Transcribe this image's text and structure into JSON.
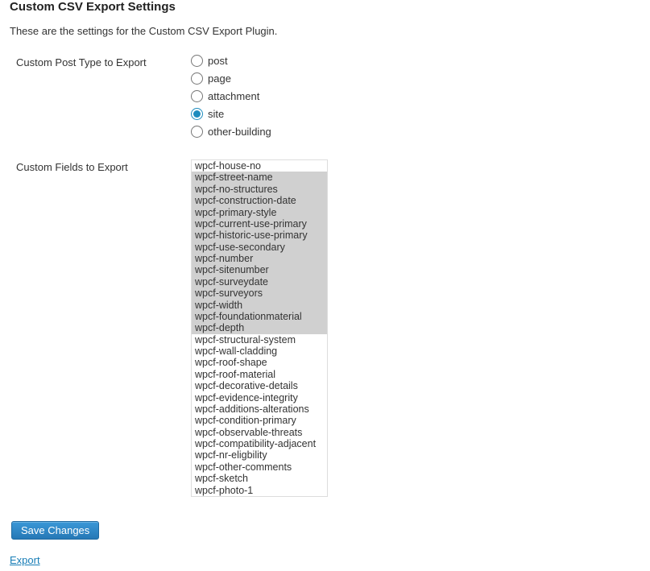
{
  "page_title": "Custom CSV Export Settings",
  "description": "These are the settings for the Custom CSV Export Plugin.",
  "post_type_section": {
    "label": "Custom Post Type to Export",
    "options": [
      {
        "label": "post",
        "checked": false
      },
      {
        "label": "page",
        "checked": false
      },
      {
        "label": "attachment",
        "checked": false
      },
      {
        "label": "site",
        "checked": true
      },
      {
        "label": "other-building",
        "checked": false
      }
    ]
  },
  "custom_fields_section": {
    "label": "Custom Fields to Export",
    "options": [
      {
        "label": "wpcf-house-no",
        "selected": false
      },
      {
        "label": "wpcf-street-name",
        "selected": true
      },
      {
        "label": "wpcf-no-structures",
        "selected": true
      },
      {
        "label": "wpcf-construction-date",
        "selected": true
      },
      {
        "label": "wpcf-primary-style",
        "selected": true
      },
      {
        "label": "wpcf-current-use-primary",
        "selected": true
      },
      {
        "label": "wpcf-historic-use-primary",
        "selected": true
      },
      {
        "label": "wpcf-use-secondary",
        "selected": true
      },
      {
        "label": "wpcf-number",
        "selected": true
      },
      {
        "label": "wpcf-sitenumber",
        "selected": true
      },
      {
        "label": "wpcf-surveydate",
        "selected": true
      },
      {
        "label": "wpcf-surveyors",
        "selected": true
      },
      {
        "label": "wpcf-width",
        "selected": true
      },
      {
        "label": "wpcf-foundationmaterial",
        "selected": true
      },
      {
        "label": "wpcf-depth",
        "selected": true
      },
      {
        "label": "wpcf-structural-system",
        "selected": false
      },
      {
        "label": "wpcf-wall-cladding",
        "selected": false
      },
      {
        "label": "wpcf-roof-shape",
        "selected": false
      },
      {
        "label": "wpcf-roof-material",
        "selected": false
      },
      {
        "label": "wpcf-decorative-details",
        "selected": false
      },
      {
        "label": "wpcf-evidence-integrity",
        "selected": false
      },
      {
        "label": "wpcf-additions-alterations",
        "selected": false
      },
      {
        "label": "wpcf-condition-primary",
        "selected": false
      },
      {
        "label": "wpcf-observable-threats",
        "selected": false
      },
      {
        "label": "wpcf-compatibility-adjacent",
        "selected": false
      },
      {
        "label": "wpcf-nr-eligbility",
        "selected": false
      },
      {
        "label": "wpcf-other-comments",
        "selected": false
      },
      {
        "label": "wpcf-sketch",
        "selected": false
      },
      {
        "label": "wpcf-photo-1",
        "selected": false
      }
    ]
  },
  "save_button_label": "Save Changes",
  "export_link_label": "Export"
}
